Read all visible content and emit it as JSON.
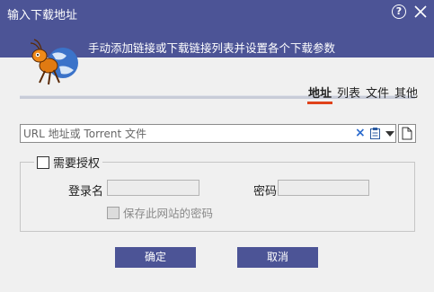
{
  "window": {
    "title": "输入下载地址",
    "help_label": "?",
    "subtitle": "手动添加链接或下载链接列表并设置各个下载参数"
  },
  "tabs": [
    {
      "label": "地址",
      "active": true
    },
    {
      "label": "列表",
      "active": false
    },
    {
      "label": "文件",
      "active": false
    },
    {
      "label": "其他",
      "active": false
    }
  ],
  "url": {
    "placeholder": "URL 地址或 Torrent 文件",
    "value": "",
    "clear_icon": "×"
  },
  "auth": {
    "checkbox_label": "需要授权",
    "checked": false,
    "username_label": "登录名",
    "password_label": "密码",
    "save_label": "保存此网站的密码"
  },
  "buttons": {
    "ok": "确定",
    "cancel": "取消"
  },
  "colors": {
    "accent": "#4c5496",
    "active_tab_underline": "#e0421a",
    "clear_icon": "#2a6acd"
  }
}
